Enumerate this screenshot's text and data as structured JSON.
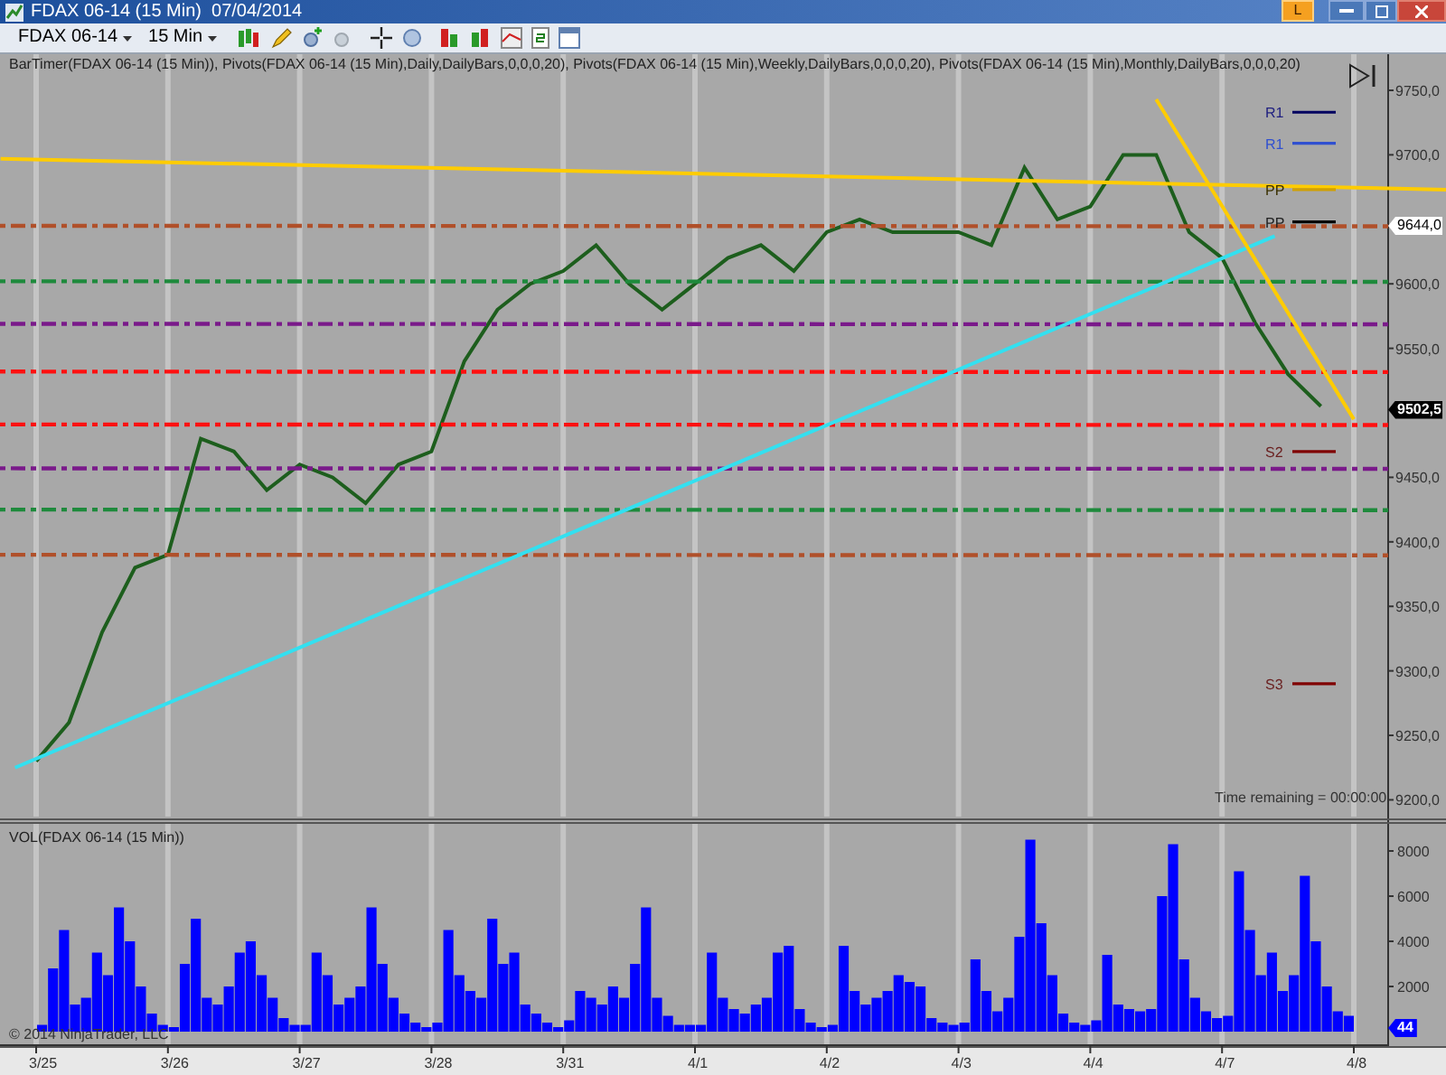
{
  "window": {
    "title": "FDAX 06-14 (15 Min)  07/04/2014",
    "badge": "L"
  },
  "toolbar": {
    "instrument": "FDAX 06-14",
    "interval": "15 Min"
  },
  "indicator_legend": "BarTimer(FDAX 06-14 (15 Min)), Pivots(FDAX 06-14 (15 Min),Daily,DailyBars,0,0,0,20), Pivots(FDAX 06-14 (15 Min),Weekly,DailyBars,0,0,0,20), Pivots(FDAX 06-14 (15 Min),Monthly,DailyBars,0,0,0,20)",
  "bar_timer": "Time remaining = 00:00:00",
  "price_chart": {
    "chart_data": {
      "type": "line",
      "ylim": [
        9187,
        9778
      ],
      "yticks": [
        {
          "value": 9750,
          "label": "9750,0"
        },
        {
          "value": 9700,
          "label": "9700,0"
        },
        {
          "value": 9600,
          "label": "9600,0"
        },
        {
          "value": 9550,
          "label": "9550,0"
        },
        {
          "value": 9450,
          "label": "9450,0"
        },
        {
          "value": 9400,
          "label": "9400,0"
        },
        {
          "value": 9350,
          "label": "9350,0"
        },
        {
          "value": 9300,
          "label": "9300,0"
        },
        {
          "value": 9250,
          "label": "9250,0"
        },
        {
          "value": 9200,
          "label": "9200,0"
        }
      ],
      "categories": [
        null,
        null,
        null,
        null,
        null,
        null,
        null,
        null,
        null,
        null,
        null,
        null,
        null,
        null,
        null,
        null,
        null,
        null,
        null,
        null,
        null,
        null,
        null,
        null,
        null,
        null,
        null,
        null,
        null,
        null,
        null,
        null,
        null,
        null,
        null,
        null,
        null,
        null,
        null,
        null
      ],
      "series": [
        {
          "color": "#1d5e1d",
          "values": [
            9230,
            9260,
            9330,
            9380,
            9390,
            9480,
            9470,
            9440,
            9460,
            9450,
            9430,
            9460,
            9470,
            9540,
            9580,
            9600,
            9610,
            9630,
            9600,
            9580,
            9600,
            9620,
            9630,
            9610,
            9640,
            9650,
            9640,
            9640,
            9640,
            9630,
            9690,
            9650,
            9660,
            9700,
            9700,
            9640,
            9620,
            9570,
            9530,
            9505
          ]
        }
      ]
    },
    "pivot_lines": [
      {
        "color": "#b0502a"
      },
      {
        "color": "#1e8a3c"
      },
      {
        "color": "#7a1a8a"
      },
      {
        "color": "#ff1010"
      },
      {
        "color": "#ff1010"
      },
      {
        "color": "#7a1a8a"
      },
      {
        "color": "#1e8a3c"
      },
      {
        "color": "#b0502a"
      }
    ],
    "trend_lines": [
      {
        "color": "#ffcc00"
      },
      {
        "color": "#33e0f0"
      },
      {
        "color": "#ffcc00"
      }
    ],
    "pivot_levels": [
      {
        "label": "R1",
        "color": "#000060"
      },
      {
        "label": "R1",
        "color": "#3050d0"
      },
      {
        "label": "PP",
        "color": "#d0a000"
      },
      {
        "label": "PP",
        "color": "#000000"
      },
      {
        "label": "S2",
        "color": "#800000"
      },
      {
        "label": "S3",
        "color": "#800000"
      }
    ],
    "price_tags": [
      "9644,0",
      "9502,5"
    ]
  },
  "volume_chart": {
    "date_labels": [
      "3/25",
      "3/26",
      "3/27",
      "3/28",
      "3/31",
      "4/1",
      "4/2",
      "4/3",
      "4/4",
      "4/7",
      "4/8"
    ],
    "chart_data": {
      "type": "bar",
      "title": "VOL(FDAX 06-14 (15 Min))",
      "ylim": [
        0,
        9280
      ],
      "yticks": [
        2000,
        4000,
        6000,
        8000
      ],
      "categories": [
        null,
        null,
        null,
        null,
        null,
        null,
        null,
        null,
        null,
        null,
        null,
        null,
        null,
        null,
        null,
        null,
        null,
        null,
        null,
        null,
        null,
        null,
        null,
        null,
        null,
        null,
        null,
        null,
        null,
        null,
        null,
        null,
        null,
        null,
        null,
        null,
        null,
        null,
        null,
        null,
        null,
        null,
        null,
        null,
        null,
        null,
        null,
        null,
        null,
        null,
        null,
        null,
        null,
        null,
        null,
        null,
        null,
        null,
        null,
        null,
        null,
        null,
        null,
        null,
        null,
        null,
        null,
        null,
        null,
        null,
        null,
        null,
        null,
        null,
        null,
        null,
        null,
        null,
        null,
        null,
        null,
        null,
        null,
        null,
        null,
        null,
        null,
        null,
        null,
        null,
        null,
        null,
        null,
        null,
        null,
        null,
        null,
        null,
        null,
        null,
        null,
        null,
        null,
        null,
        null,
        null,
        null,
        null,
        null,
        null,
        null,
        null,
        null,
        null,
        null,
        null,
        null,
        null,
        null,
        null
      ],
      "series": [
        {
          "color": "#0000ff",
          "values": [
            300,
            2800,
            4500,
            1200,
            1500,
            3500,
            2500,
            5500,
            4000,
            2000,
            800,
            300,
            200,
            3000,
            5000,
            1500,
            1200,
            2000,
            3500,
            4000,
            2500,
            1500,
            600,
            300,
            300,
            3500,
            2500,
            1200,
            1500,
            2000,
            5500,
            3000,
            1500,
            800,
            400,
            200,
            400,
            4500,
            2500,
            1800,
            1500,
            5000,
            3000,
            3500,
            1200,
            800,
            400,
            200,
            500,
            1800,
            1500,
            1200,
            2000,
            1500,
            3000,
            5500,
            1500,
            700,
            300,
            300,
            300,
            3500,
            1500,
            1000,
            800,
            1200,
            1500,
            3500,
            3800,
            1000,
            400,
            200,
            300,
            3800,
            1800,
            1200,
            1500,
            1800,
            2500,
            2200,
            2000,
            600,
            400,
            300,
            400,
            3200,
            1800,
            900,
            1500,
            4200,
            8500,
            4800,
            2500,
            800,
            400,
            300,
            500,
            3400,
            1200,
            1000,
            900,
            1000,
            6000,
            8300,
            3200,
            1500,
            900,
            600,
            700,
            7100,
            4500,
            2500,
            3500,
            1800,
            2500,
            6900,
            4000,
            2000,
            900,
            700
          ]
        }
      ]
    },
    "volume_tag": "44",
    "copyright": "© 2014 NinjaTrader, LLC"
  }
}
